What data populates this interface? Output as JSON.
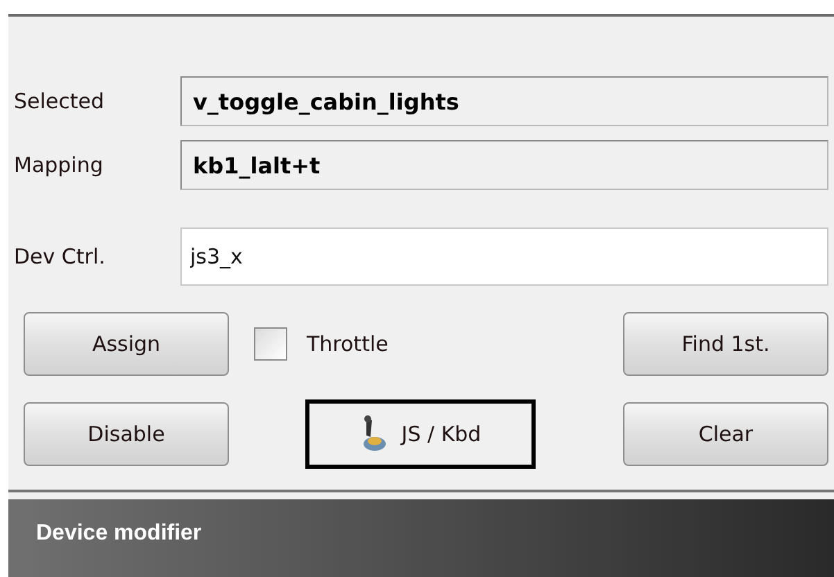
{
  "fields": [
    {
      "label": "Selected",
      "value": "v_toggle_cabin_lights",
      "kind": "readonly"
    },
    {
      "label": "Mapping",
      "value": "kb1_lalt+t",
      "kind": "readonly"
    },
    {
      "label": "Dev Ctrl.",
      "value": "js3_x",
      "kind": "input"
    }
  ],
  "buttons_row_1": {
    "assign": "Assign",
    "throttle": {
      "label": "Throttle",
      "checked": false
    },
    "find": "Find 1st."
  },
  "buttons_row_2": {
    "disable": "Disable",
    "mode": "JS / Kbd",
    "clear": "Clear"
  },
  "section_header": "Device modifier"
}
